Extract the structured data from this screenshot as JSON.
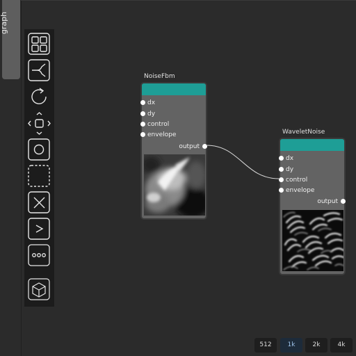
{
  "side_tab": {
    "label": "graph"
  },
  "toolbar": {
    "tools": [
      {
        "name": "layout-icon"
      },
      {
        "name": "branch-icon"
      },
      {
        "name": "refresh-icon"
      },
      {
        "name": "move-icon"
      },
      {
        "name": "circle-icon"
      },
      {
        "name": "dashed-square-icon"
      },
      {
        "name": "close-icon"
      },
      {
        "name": "chevron-right-icon"
      },
      {
        "name": "more-icon"
      },
      {
        "name": "cube-icon"
      }
    ]
  },
  "nodes": [
    {
      "title": "NoiseFbm",
      "header_color": "#1e9e96",
      "inputs": [
        "dx",
        "dy",
        "control",
        "envelope"
      ],
      "output": "output"
    },
    {
      "title": "WaveletNoise",
      "header_color": "#1e9e96",
      "inputs": [
        "dx",
        "dy",
        "control",
        "envelope"
      ],
      "output": "output"
    }
  ],
  "resolutions": [
    {
      "label": "512",
      "active": false
    },
    {
      "label": "1k",
      "active": true
    },
    {
      "label": "2k",
      "active": false
    },
    {
      "label": "4k",
      "active": false
    }
  ]
}
